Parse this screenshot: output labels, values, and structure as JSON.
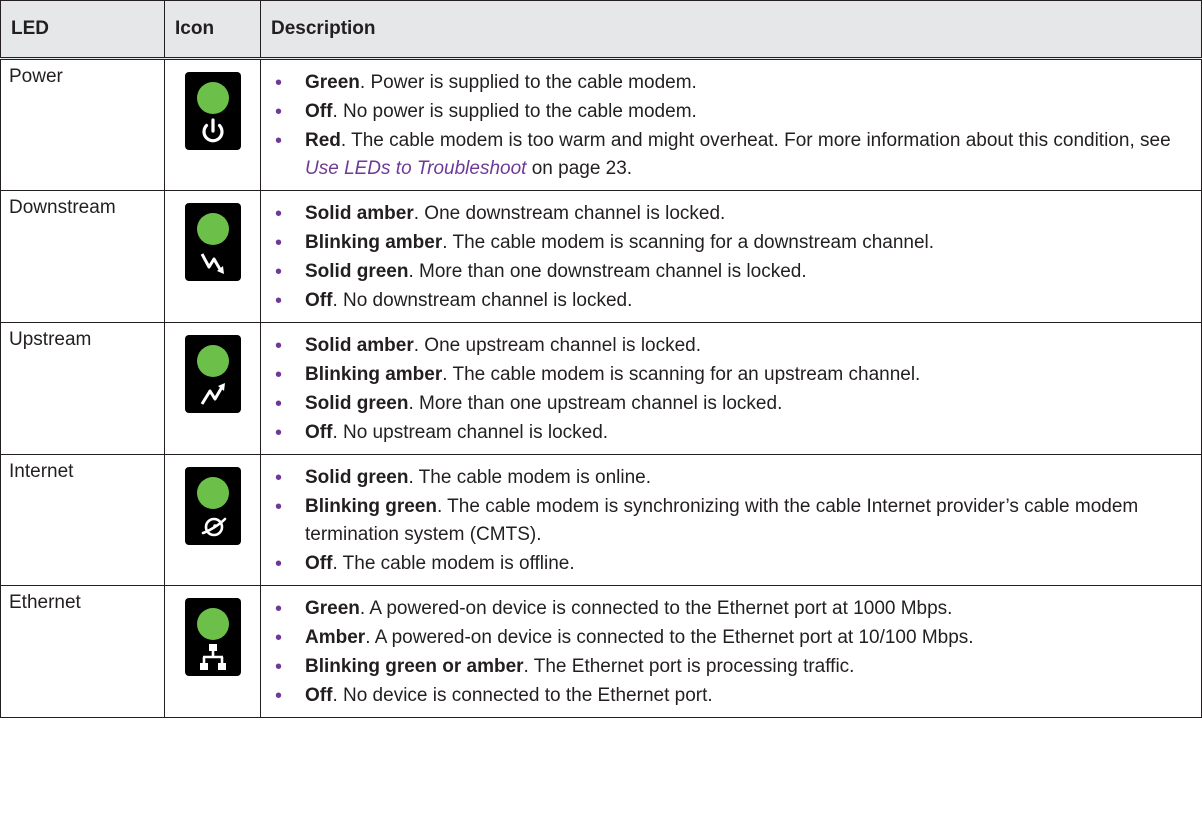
{
  "table": {
    "headers": {
      "led": "LED",
      "icon": "Icon",
      "description": "Description"
    },
    "led_color": "#6cc04a",
    "bullet_color": "#6f3a97",
    "rows": [
      {
        "led": "Power",
        "icon": "power-icon",
        "items": [
          {
            "term": "Green",
            "text": ". Power is supplied to the cable modem."
          },
          {
            "term": "Off",
            "text": ". No power is supplied to the cable modem."
          },
          {
            "term": "Red",
            "text": ". The cable modem is too warm and might overheat. For more information about this condition, see ",
            "link": "Use LEDs to Troubleshoot",
            "after": " on page 23."
          }
        ]
      },
      {
        "led": "Downstream",
        "icon": "downstream-icon",
        "items": [
          {
            "term": "Solid amber",
            "text": ". One downstream channel is locked."
          },
          {
            "term": "Blinking amber",
            "text": ". The cable modem is scanning for a downstream channel."
          },
          {
            "term": "Solid green",
            "text": ". More than one downstream channel is locked."
          },
          {
            "term": "Off",
            "text": ". No downstream channel is locked."
          }
        ]
      },
      {
        "led": "Upstream",
        "icon": "upstream-icon",
        "items": [
          {
            "term": "Solid amber",
            "text": ". One upstream channel is locked."
          },
          {
            "term": "Blinking amber",
            "text": ". The cable modem is scanning for an upstream channel."
          },
          {
            "term": "Solid green",
            "text": ". More than one upstream channel is locked."
          },
          {
            "term": "Off",
            "text": ". No upstream channel is locked."
          }
        ]
      },
      {
        "led": "Internet",
        "icon": "internet-icon",
        "items": [
          {
            "term": "Solid green",
            "text": ". The cable modem is online."
          },
          {
            "term": "Blinking green",
            "text": ". The cable modem is synchronizing with the cable Internet provider’s cable modem termination system (CMTS)."
          },
          {
            "term": "Off",
            "text": ". The cable modem is offline."
          }
        ]
      },
      {
        "led": "Ethernet",
        "icon": "ethernet-icon",
        "items": [
          {
            "term": "Green",
            "text": ". A powered-on device is connected to the Ethernet port at 1000 Mbps."
          },
          {
            "term": "Amber",
            "text": ". A powered-on device is connected to the Ethernet port at 10/100 Mbps."
          },
          {
            "term": "Blinking green or amber",
            "text": ". The Ethernet port is processing traffic."
          },
          {
            "term": "Off",
            "text": ". No device is connected to the Ethernet port."
          }
        ]
      }
    ]
  }
}
